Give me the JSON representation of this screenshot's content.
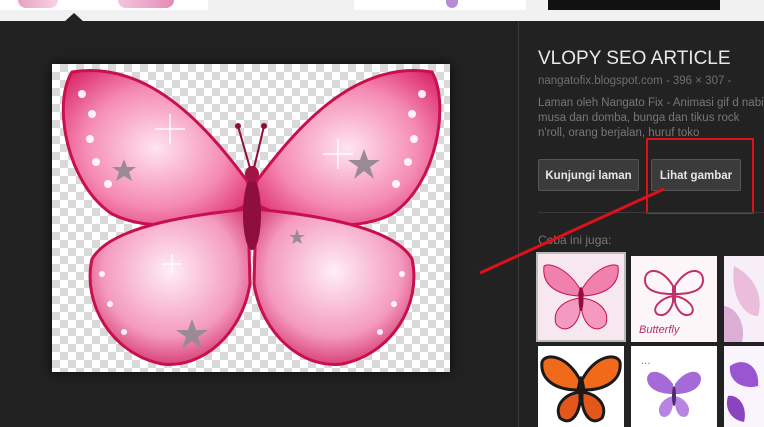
{
  "result": {
    "title": "VLOPY SEO ARTICLE",
    "source": "nangatofix.blogspot.com - 396 × 307 - ",
    "description": "Laman oleh Nangato Fix - Animasi gif d nabi musa dan domba, bunga dan tikus rock n'roll, orang berjalan, huruf toko"
  },
  "buttons": {
    "visit_label": "Kunjungi laman",
    "view_label": "Lihat gambar"
  },
  "related": {
    "label": "Coba ini juga:",
    "items": [
      {
        "caption": ""
      },
      {
        "caption": "Butterfly"
      },
      {
        "caption": ""
      },
      {
        "caption": ""
      },
      {
        "caption": ""
      },
      {
        "caption": ""
      }
    ]
  },
  "colors": {
    "highlight": "#e0101b",
    "background": "#222222",
    "button": "#3b3b3b"
  }
}
